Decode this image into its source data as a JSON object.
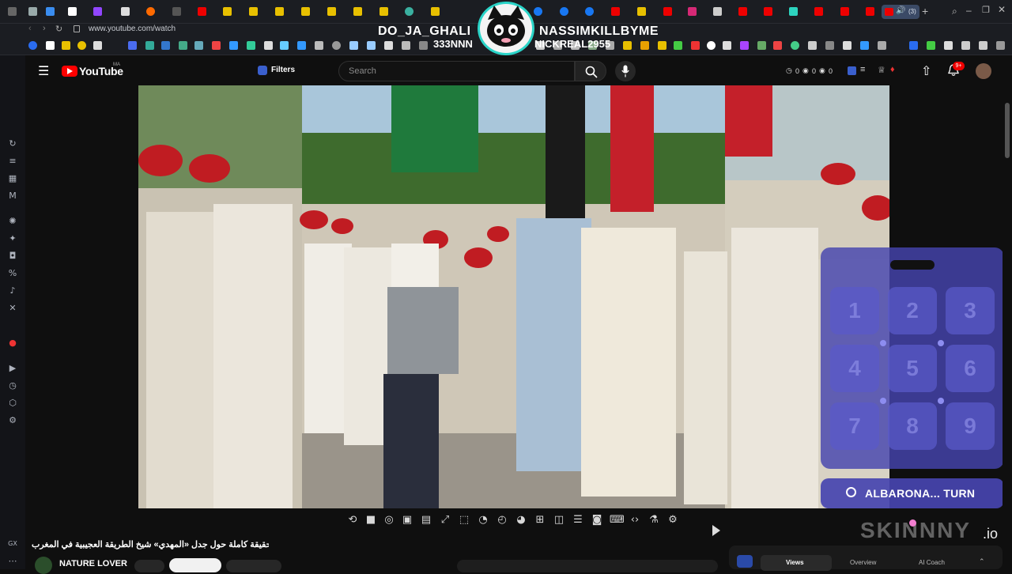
{
  "browser": {
    "url": "www.youtube.com/watch",
    "tab_badge": "(3)"
  },
  "overlay": {
    "left_name": "DO_JA_GHALI",
    "left_sub": "333NNN",
    "right_name": "NASSIMKILLBYME",
    "right_sub": "NICKREAL2955"
  },
  "yt_header": {
    "logo_text": "YouTube",
    "region": "MA",
    "filters_label": "Filters",
    "search_placeholder": "Search",
    "stats": [
      "0",
      "0",
      "0"
    ],
    "notif_badge": "9+"
  },
  "video": {
    "title": "الحقيقة كاملة حول جدل «المهدي» شيخ الطريقة العجيبية في المغرب",
    "channel": "NATURE LOVER"
  },
  "keypad": {
    "keys": [
      "1",
      "2",
      "3",
      "4",
      "5",
      "6",
      "7",
      "8",
      "9"
    ],
    "turn_label": "ALBARONA... TURN"
  },
  "watermark": {
    "brand": "SKINNNY",
    "tld": ".io"
  },
  "side_panel": {
    "tabs": [
      "Views",
      "Overview",
      "AI Coach"
    ]
  },
  "colors": {
    "yt_red": "#ff0000",
    "keypad_bg": "#4644af",
    "overlay_teal": "#2ad4c8"
  }
}
